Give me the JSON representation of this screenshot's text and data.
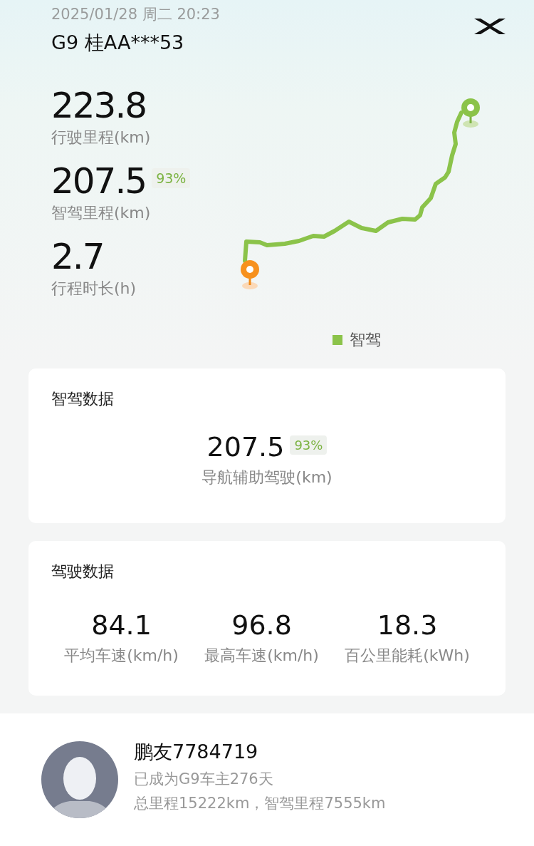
{
  "header": {
    "datetime": "2025/01/28 周二 20:23",
    "vehicle": "G9 桂AA***53"
  },
  "stats": [
    {
      "value": "223.8",
      "label": "行驶里程(km)"
    },
    {
      "value": "207.5",
      "badge": "93%",
      "label": "智驾里程(km)"
    },
    {
      "value": "2.7",
      "label": "行程时长(h)"
    }
  ],
  "map": {
    "legend": [
      {
        "label": "智驾",
        "color": "#8bc34a"
      }
    ]
  },
  "cards": [
    {
      "kind": "single",
      "title": "智驾数据",
      "items": [
        {
          "value": "207.5",
          "badge": "93%",
          "label": "导航辅助驾驶(km)"
        }
      ]
    },
    {
      "kind": "triple",
      "title": "驾驶数据",
      "items": [
        {
          "value": "84.1",
          "label": "平均车速(km/h)"
        },
        {
          "value": "96.8",
          "label": "最高车速(km/h)"
        },
        {
          "value": "18.3",
          "label": "百公里能耗(kWh)"
        }
      ]
    }
  ],
  "profile": {
    "name": "鹏友7784719",
    "owner_days": "已成为G9车主276天",
    "mileage": "总里程15222km，智驾里程7555km"
  }
}
